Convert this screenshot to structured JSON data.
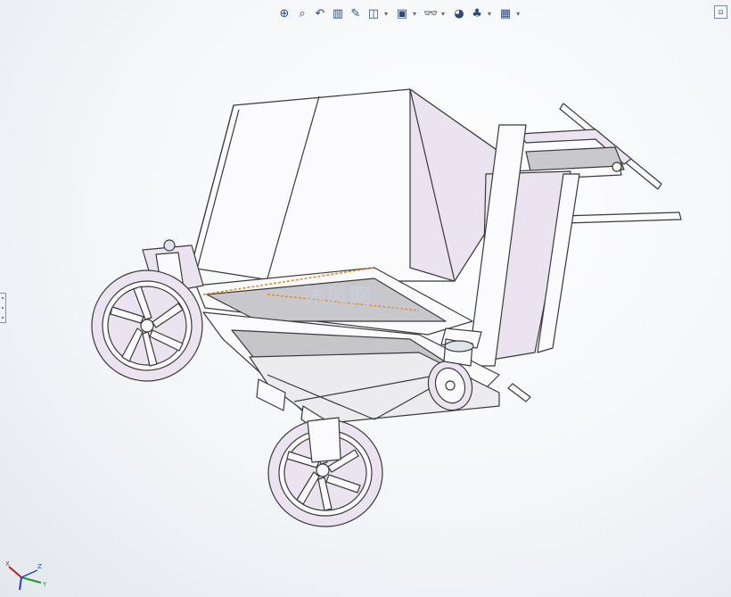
{
  "toolbar": {
    "items": [
      {
        "icon": "zoom-to-fit-icon",
        "glyph": "⊕",
        "has_menu": false
      },
      {
        "icon": "zoom-to-area-icon",
        "glyph": "⌕",
        "has_menu": false
      },
      {
        "icon": "previous-view-icon",
        "glyph": "↶",
        "has_menu": false
      },
      {
        "icon": "section-view-icon",
        "glyph": "▥",
        "has_menu": false
      },
      {
        "icon": "dynamic-annotation-icon",
        "glyph": "✎",
        "has_menu": false
      },
      {
        "icon": "view-orientation-icon",
        "glyph": "◫",
        "has_menu": true
      },
      {
        "icon": "display-style-icon",
        "glyph": "▣",
        "has_menu": true
      },
      {
        "icon": "hide-show-items-icon",
        "glyph": "👓",
        "has_menu": true
      },
      {
        "icon": "edit-appearance-icon",
        "glyph": "◕",
        "has_menu": false
      },
      {
        "icon": "apply-scene-icon",
        "glyph": "♣",
        "has_menu": true
      },
      {
        "icon": "view-settings-icon",
        "glyph": "▦",
        "has_menu": true
      }
    ],
    "menu_arrow": "▾"
  },
  "corner_button": "⊡",
  "watermark": {
    "text": "沐风网",
    "sub": "www.mfcad.com"
  },
  "triad": {
    "x": "X",
    "y": "Y",
    "z": "Z"
  },
  "colors": {
    "part_fill": "#ece3f0",
    "part_white": "#fbfbfd",
    "edge": "#3a3a3a",
    "highlight_edge": "#e08a2a",
    "background": "#f1f3f6"
  }
}
